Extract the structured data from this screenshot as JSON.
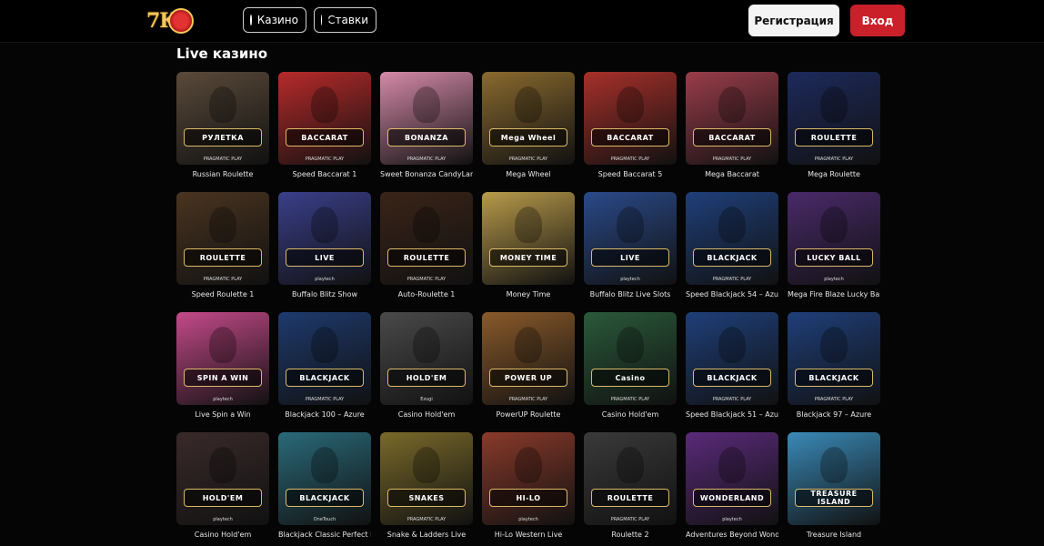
{
  "header": {
    "logo_text": "7K",
    "logo_icon": "maple-leaf-icon",
    "nav": [
      {
        "label": "Казино",
        "icon": "casino-chip-icon"
      },
      {
        "label": "Ставки",
        "icon": "soccer-ball-icon"
      }
    ],
    "register_label": "Регистрация",
    "login_label": "Вход",
    "colors": {
      "login": "#c9202a",
      "register": "#f4f4f4"
    }
  },
  "section": {
    "title": "Live казино"
  },
  "games": [
    {
      "label": "Russian Roulette",
      "banner": "РУЛЕТКА",
      "provider": "PRAGMATIC PLAY",
      "color": "#5a4a3a"
    },
    {
      "label": "Speed Baccarat 1",
      "banner": "BACCARAT",
      "provider": "PRAGMATIC PLAY",
      "color": "#b82a2a"
    },
    {
      "label": "Sweet Bonanza CandyLand",
      "banner": "BONANZA",
      "provider": "PRAGMATIC PLAY",
      "color": "#d58aa8"
    },
    {
      "label": "Mega Wheel",
      "banner": "Mega Wheel",
      "provider": "PRAGMATIC PLAY",
      "color": "#8a6a2e"
    },
    {
      "label": "Speed Baccarat 5",
      "banner": "BACCARAT",
      "provider": "PRAGMATIC PLAY",
      "color": "#a8302a"
    },
    {
      "label": "Mega Baccarat",
      "banner": "BACCARAT",
      "provider": "PRAGMATIC PLAY",
      "color": "#9a3d4a"
    },
    {
      "label": "Mega Roulette",
      "banner": "ROULETTE",
      "provider": "PRAGMATIC PLAY",
      "color": "#1d2a5c"
    },
    {
      "label": "Speed Roulette 1",
      "banner": "ROULETTE",
      "provider": "PRAGMATIC PLAY",
      "color": "#4a3420"
    },
    {
      "label": "Buffalo Blitz Show",
      "banner": "LIVE",
      "provider": "playtech",
      "color": "#3a3f8a"
    },
    {
      "label": "Auto-Roulette 1",
      "banner": "ROULETTE",
      "provider": "PRAGMATIC PLAY",
      "color": "#3a2418"
    },
    {
      "label": "Money Time",
      "banner": "MONEY TIME",
      "provider": "",
      "color": "#b89a4a"
    },
    {
      "label": "Buffalo Blitz Live Slots",
      "banner": "LIVE",
      "provider": "playtech",
      "color": "#2a4a8a"
    },
    {
      "label": "Speed Blackjack 54 – Azure",
      "banner": "BLACKJACK",
      "provider": "PRAGMATIC PLAY",
      "color": "#1f3f7a"
    },
    {
      "label": "Mega Fire Blaze Lucky Ball",
      "banner": "LUCKY BALL",
      "provider": "playtech",
      "color": "#4a2a6a"
    },
    {
      "label": "Live Spin a Win",
      "banner": "SPIN A WIN",
      "provider": "playtech",
      "color": "#c54a8a"
    },
    {
      "label": "Blackjack 100 – Azure",
      "banner": "BLACKJACK",
      "provider": "PRAGMATIC PLAY",
      "color": "#1e3a6e"
    },
    {
      "label": "Casino Hold'em",
      "banner": "HOLD'EM",
      "provider": "Ezugi",
      "color": "#4a4a4a"
    },
    {
      "label": "PowerUP Roulette",
      "banner": "POWER UP",
      "provider": "PRAGMATIC PLAY",
      "color": "#8a5a2a"
    },
    {
      "label": "Casino Hold'em",
      "banner": "Casino",
      "provider": "PRAGMATIC PLAY",
      "color": "#2a5a3a"
    },
    {
      "label": "Speed Blackjack 51 – Azure",
      "banner": "BLACKJACK",
      "provider": "PRAGMATIC PLAY",
      "color": "#1f3f7a"
    },
    {
      "label": "Blackjack 97 – Azure",
      "banner": "BLACKJACK",
      "provider": "PRAGMATIC PLAY",
      "color": "#1f3f7a"
    },
    {
      "label": "Casino Hold'em",
      "banner": "HOLD'EM",
      "provider": "playtech",
      "color": "#3a2a2a"
    },
    {
      "label": "Blackjack Classic Perfect Pairs",
      "banner": "BLACKJACK",
      "provider": "OneTouch",
      "color": "#2a6a7a"
    },
    {
      "label": "Snake & Ladders Live",
      "banner": "SNAKES",
      "provider": "PRAGMATIC PLAY",
      "color": "#7a6a2a"
    },
    {
      "label": "Hi-Lo Western Live",
      "banner": "HI-LO",
      "provider": "playtech",
      "color": "#8a3a2a"
    },
    {
      "label": "Roulette 2",
      "banner": "ROULETTE",
      "provider": "PRAGMATIC PLAY",
      "color": "#3a3a3a"
    },
    {
      "label": "Adventures Beyond Wonderland",
      "banner": "WONDERLAND",
      "provider": "playtech",
      "color": "#5a2a7a"
    },
    {
      "label": "Treasure Island",
      "banner": "TREASURE ISLAND",
      "provider": "",
      "color": "#3a8ab8"
    }
  ]
}
